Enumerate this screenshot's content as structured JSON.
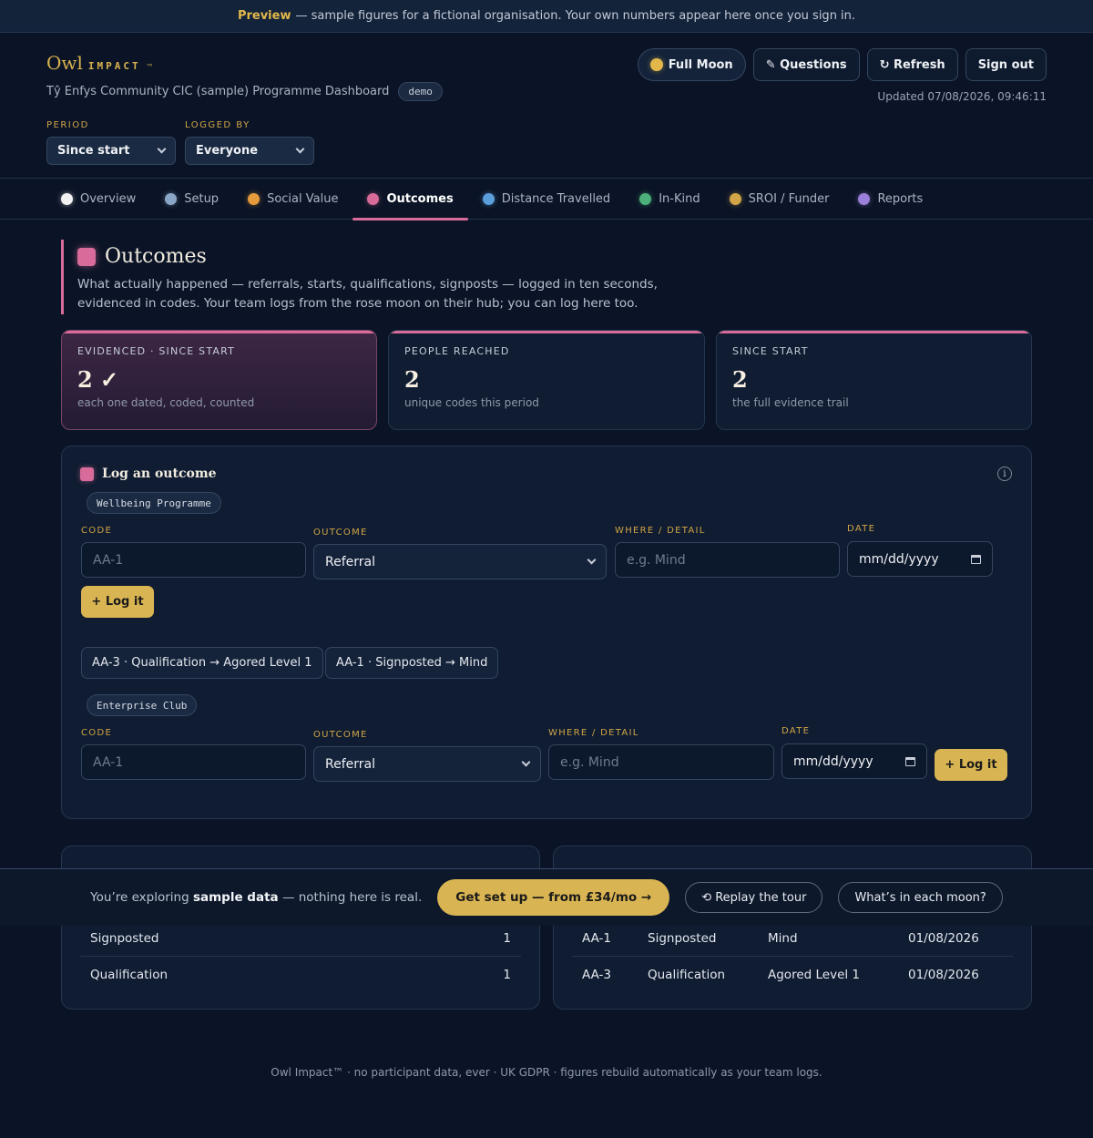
{
  "banner": {
    "strong": "Preview",
    "text": "— sample figures for a fictional organisation. Your own numbers appear here once you sign in."
  },
  "brand": {
    "name": "Owl",
    "suffix": "IMPACT",
    "tm": "™"
  },
  "org": {
    "title": "Tŷ Enfys Community CIC (sample) Programme Dashboard",
    "badge": "demo"
  },
  "header": {
    "moon_button": "Full Moon",
    "questions": "✎ Questions",
    "refresh": "↻ Refresh",
    "signout": "Sign out",
    "updated": "Updated 07/08/2026, 09:46:11"
  },
  "filters": {
    "period_label": "PERIOD",
    "period_value": "Since start",
    "logged_label": "LOGGED BY",
    "logged_value": "Everyone"
  },
  "tabs": [
    {
      "label": "Overview",
      "color": "#f2f2f2"
    },
    {
      "label": "Setup",
      "color": "#8aa6c6"
    },
    {
      "label": "Social Value",
      "color": "#e69c3c"
    },
    {
      "label": "Outcomes",
      "color": "#d96b9a"
    },
    {
      "label": "Distance Travelled",
      "color": "#5a9fdc"
    },
    {
      "label": "In-Kind",
      "color": "#4db07a"
    },
    {
      "label": "SROI / Funder",
      "color": "#d1a548"
    },
    {
      "label": "Reports",
      "color": "#9b7fd8"
    }
  ],
  "section": {
    "title": "Outcomes",
    "desc1": "What actually happened — referrals, starts, qualifications, signposts — logged in ten seconds,",
    "desc2": "evidenced in codes. Your team logs from the rose moon on their hub; you can log here too."
  },
  "stats": [
    {
      "label": "EVIDENCED · SINCE START",
      "value": "2 ✓",
      "sub": "each one dated, coded, counted"
    },
    {
      "label": "PEOPLE REACHED",
      "value": "2",
      "sub": "unique codes this period"
    },
    {
      "label": "SINCE START",
      "value": "2",
      "sub": "the full evidence trail"
    }
  ],
  "log": {
    "title": "Log an outcome",
    "info": "i",
    "programmes": [
      {
        "name": "Wellbeing Programme",
        "code_label": "CODE",
        "code_placeholder": "AA-1",
        "outcome_label": "OUTCOME",
        "outcome_value": "Referral",
        "where_label": "WHERE / DETAIL",
        "where_placeholder": "e.g. Mind",
        "date_label": "DATE",
        "date_value": "mm/dd/yyyy",
        "button": "+ Log it",
        "chips": [
          "AA-3 · Qualification → Agored Level 1",
          "AA-1 · Signposted → Mind"
        ]
      },
      {
        "name": "Enterprise Club",
        "code_label": "CODE",
        "code_placeholder": "AA-1",
        "outcome_label": "OUTCOME",
        "outcome_value": "Referral",
        "where_label": "WHERE / DETAIL",
        "where_placeholder": "e.g. Mind",
        "date_label": "DATE",
        "date_value": "mm/dd/yyyy",
        "button": "+ Log it"
      }
    ]
  },
  "by_type": [
    {
      "type": "Signposted",
      "count": "1"
    },
    {
      "type": "Qualification",
      "count": "1"
    }
  ],
  "recent": [
    {
      "code": "AA-1",
      "outcome": "Signposted",
      "detail": "Mind",
      "date": "01/08/2026"
    },
    {
      "code": "AA-3",
      "outcome": "Qualification",
      "detail": "Agored Level 1",
      "date": "01/08/2026"
    }
  ],
  "samplebar": {
    "pre": "You’re exploring",
    "strong": "sample data",
    "post": "— nothing here is real.",
    "cta": "Get set up — from £34/mo →",
    "replay": "⟲ Replay the tour",
    "moons": "What’s in each moon?"
  },
  "footer": "Owl Impact™ · no participant data, ever · UK GDPR · figures rebuild automatically as your team logs."
}
